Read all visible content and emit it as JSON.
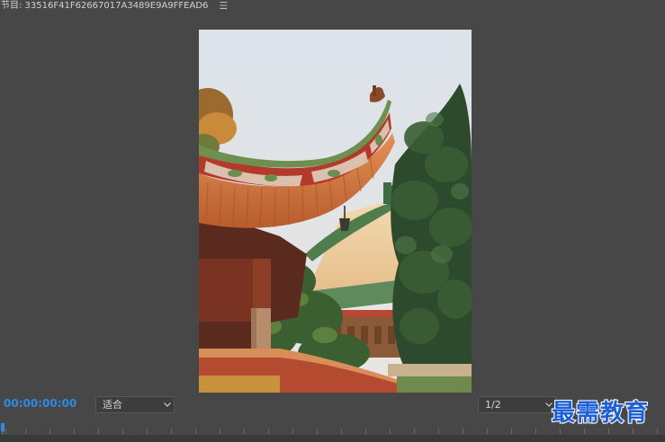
{
  "header": {
    "title": "节目: 33516F41F62667017A3489E9A9FFEAD6",
    "menu_icon": "hamburger-menu-icon"
  },
  "preview": {
    "content": "temple-roof-photo"
  },
  "controls": {
    "timecode": "00:00:00:00",
    "fit_select": "适合",
    "resolution_select": "1/2"
  },
  "watermark": {
    "text": "最需教育"
  },
  "colors": {
    "background": "#474747",
    "timecode": "#2f8ae2",
    "playhead": "#2f8ae2",
    "watermark": "#1f5fd6"
  }
}
